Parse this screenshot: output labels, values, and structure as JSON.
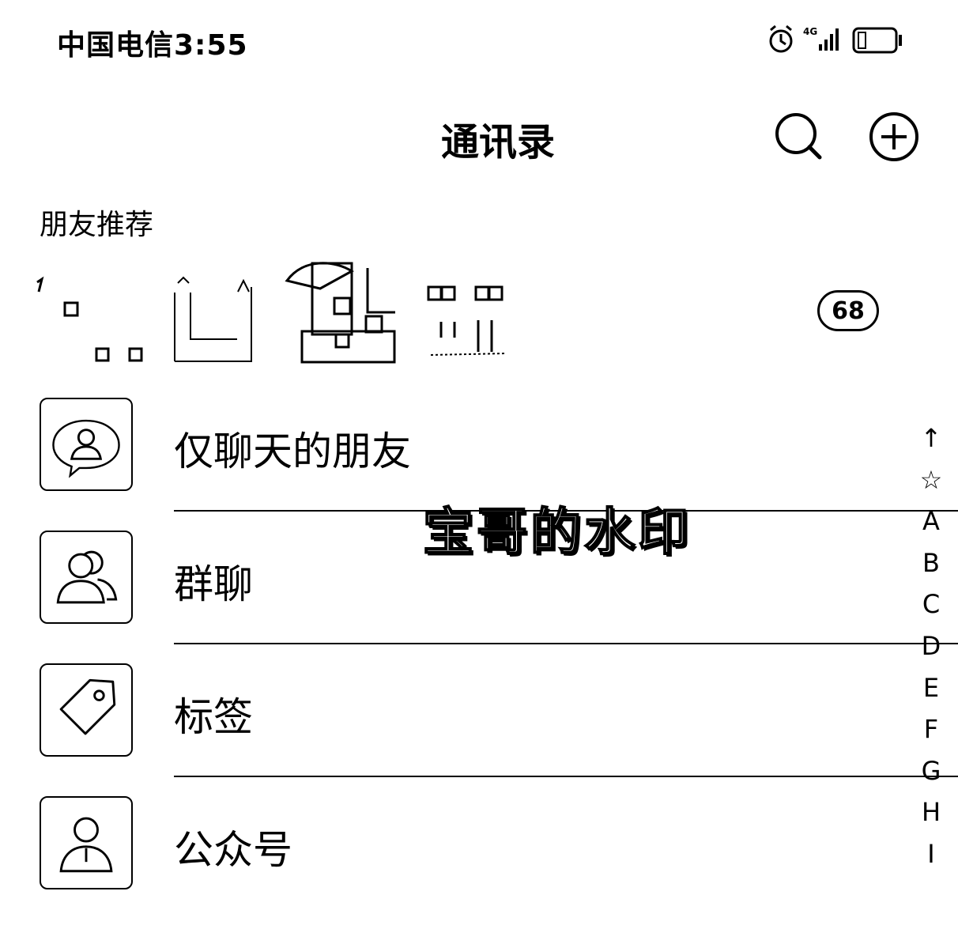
{
  "status_bar": {
    "carrier_time": "中国电信3:55",
    "network": "4G",
    "icons": [
      "alarm-icon",
      "signal-icon",
      "battery-icon"
    ]
  },
  "header": {
    "title": "通讯录",
    "search_icon": "search-icon",
    "add_icon": "plus-circle-icon"
  },
  "recommend": {
    "label": "朋友推荐",
    "badge_count": "68"
  },
  "menu": {
    "items": [
      {
        "label": "仅聊天的朋友",
        "icon": "chat-only-friend-icon"
      },
      {
        "label": "群聊",
        "icon": "group-chat-icon"
      },
      {
        "label": "标签",
        "icon": "tag-icon"
      },
      {
        "label": "公众号",
        "icon": "official-account-icon"
      }
    ]
  },
  "index": [
    "↑",
    "☆",
    "A",
    "B",
    "C",
    "D",
    "E",
    "F",
    "G",
    "H",
    "I"
  ],
  "watermark": "宝哥的水印"
}
